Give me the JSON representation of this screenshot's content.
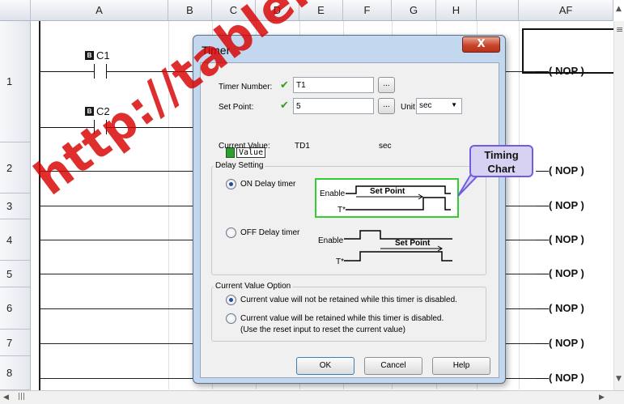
{
  "spreadsheet": {
    "columns": [
      "A",
      "B",
      "C",
      "D",
      "E",
      "F",
      "G",
      "H",
      "AF"
    ],
    "rows": [
      "1",
      "2",
      "3",
      "4",
      "5",
      "6",
      "7",
      "8"
    ],
    "contacts": [
      {
        "name": "C1"
      },
      {
        "name": "C2"
      }
    ],
    "nop_label": "( NOP )",
    "scroll_up": "▲",
    "scroll_down": "▼",
    "scroll_left": "◀",
    "scroll_right": "▶",
    "scroll_grip": "≡",
    "hscroll_grip": "|||",
    "contact_icon": "B"
  },
  "dialog": {
    "title": "Timer",
    "close_label": "X",
    "timer_number_label": "Timer Number:",
    "timer_number_value": "T1",
    "set_point_label": "Set Point:",
    "set_point_value": "5",
    "unit_label": "Unit",
    "unit_value": "sec",
    "browse_label": "...",
    "value_tag": "Value",
    "current_value_label": "Current Value:",
    "current_value": "TD1",
    "current_value_unit": "sec",
    "delay_setting_title": "Delay Setting",
    "on_delay_label": "ON Delay timer",
    "off_delay_label": "OFF Delay timer",
    "enable_label": "Enable",
    "set_point_tag": "Set Point",
    "t_label": "T*",
    "current_value_option_title": "Current Value Option",
    "option_not_retained": "Current value will not be retained while this timer is disabled.",
    "option_retained": "Current value will be retained while this timer is disabled.",
    "option_retained_note": "(Use the reset input to reset the current value)",
    "ok_label": "OK",
    "cancel_label": "Cancel",
    "help_label": "Help"
  },
  "callout": {
    "line1": "Timing",
    "line2": "Chart"
  },
  "watermark": "http://tableros",
  "colors": {
    "check": "#3a9a1e",
    "callout_border": "#6f5fe0",
    "highlight_box": "#33cc33",
    "watermark": "#d70000"
  }
}
